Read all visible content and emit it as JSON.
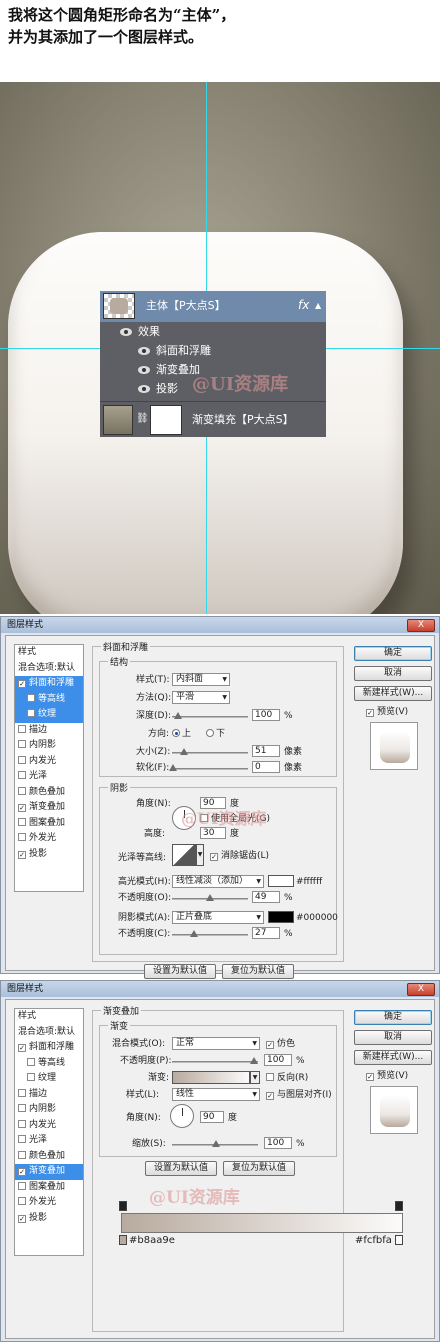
{
  "intro": {
    "line1": "我将这个圆角矩形命名为“主体”，",
    "line2": "并为其添加了一个图层样式。"
  },
  "layers_panel": {
    "layer1_name": "主体【P大点S】",
    "fx_label": "fx",
    "effects_label": "效果",
    "effects": [
      "斜面和浮雕",
      "渐变叠加",
      "投影"
    ],
    "layer2_name": "渐变填充【P大点S】"
  },
  "watermark": "@UI资源库",
  "dialog": {
    "title": "图层样式",
    "close": "X",
    "styles_header": "样式",
    "blend_default": "混合选项:默认",
    "style_items": [
      {
        "label": "斜面和浮雕",
        "checked": true
      },
      {
        "label": "等高线",
        "checked": false
      },
      {
        "label": "纹理",
        "checked": false
      },
      {
        "label": "描边",
        "checked": false
      },
      {
        "label": "内阴影",
        "checked": false
      },
      {
        "label": "内发光",
        "checked": false
      },
      {
        "label": "光泽",
        "checked": false
      },
      {
        "label": "颜色叠加",
        "checked": false
      },
      {
        "label": "渐变叠加",
        "checked": true
      },
      {
        "label": "图案叠加",
        "checked": false
      },
      {
        "label": "外发光",
        "checked": false
      },
      {
        "label": "投影",
        "checked": true
      }
    ],
    "ok": "确定",
    "cancel": "取消",
    "new_style": "新建样式(W)...",
    "preview": "预览(V)",
    "make_default": "设置为默认值",
    "reset_default": "复位为默认值"
  },
  "bevel": {
    "panel_title": "斜面和浮雕",
    "structure": "结构",
    "style_label": "样式(T):",
    "style_value": "内斜面",
    "technique_label": "方法(Q):",
    "technique_value": "平滑",
    "depth_label": "深度(D):",
    "depth_value": "100",
    "depth_unit": "%",
    "direction_label": "方向:",
    "dir_up": "上",
    "dir_down": "下",
    "size_label": "大小(Z):",
    "size_value": "51",
    "size_unit": "像素",
    "soften_label": "软化(F):",
    "soften_value": "0",
    "soften_unit": "像素",
    "shading": "阴影",
    "angle_label": "角度(N):",
    "angle_value": "90",
    "angle_unit": "度",
    "global_light": "使用全局光(G)",
    "altitude_label": "高度:",
    "altitude_value": "30",
    "altitude_unit": "度",
    "gloss_contour_label": "光泽等高线:",
    "anti_aliased": "消除锯齿(L)",
    "highlight_mode_label": "高光模式(H):",
    "highlight_mode_value": "线性减淡（添加）",
    "highlight_color": "#ffffff",
    "highlight_opacity_label": "不透明度(O):",
    "highlight_opacity_value": "49",
    "pct": "%",
    "shadow_mode_label": "阴影模式(A):",
    "shadow_mode_value": "正片叠底",
    "shadow_color": "#000000",
    "shadow_opacity_label": "不透明度(C):",
    "shadow_opacity_value": "27"
  },
  "gradient": {
    "panel_title": "渐变叠加",
    "section": "渐变",
    "blend_label": "混合模式(O):",
    "blend_value": "正常",
    "dither": "仿色",
    "opacity_label": "不透明度(P):",
    "opacity_value": "100",
    "pct": "%",
    "gradient_label": "渐变:",
    "reverse": "反向(R)",
    "style_label": "样式(L):",
    "style_value": "线性",
    "align": "与图层对齐(I)",
    "angle_label": "角度(N):",
    "angle_value": "90",
    "angle_unit": "度",
    "scale_label": "缩放(S):",
    "scale_value": "100",
    "stop_left": "#b8aa9e",
    "stop_right": "#fcfbfa"
  }
}
